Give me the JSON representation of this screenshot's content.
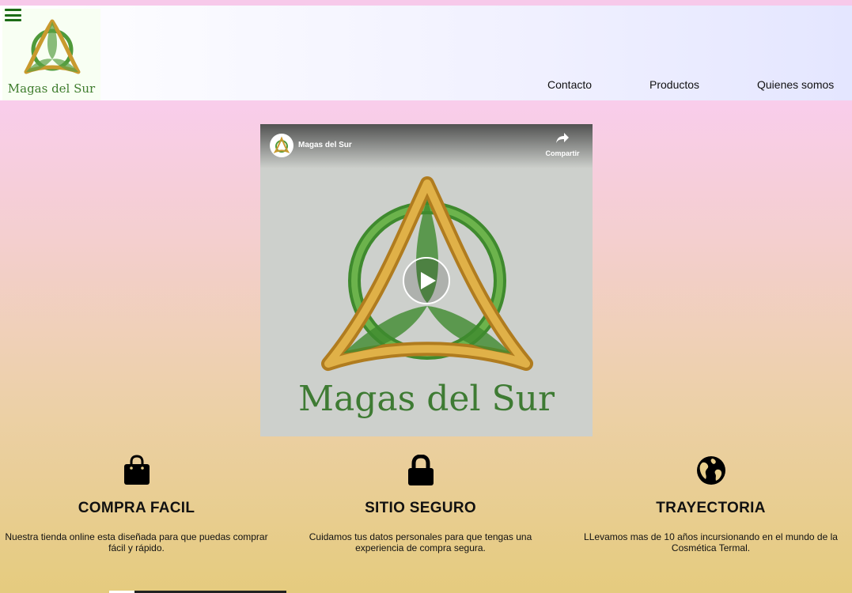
{
  "header": {
    "logo_text": "Magas del Sur",
    "nav": {
      "contact": "Contacto",
      "products": "Productos",
      "about": "Quienes somos"
    }
  },
  "video": {
    "channel": "Magas del Sur",
    "share_label": "Compartir",
    "title_art": "Magas del Sur"
  },
  "features": [
    {
      "icon": "shopping-bag-icon",
      "title": "COMPRA FACIL",
      "text": "Nuestra tienda online esta diseñada para que puedas comprar fácil y rápido."
    },
    {
      "icon": "lock-icon",
      "title": "SITIO SEGURO",
      "text": "Cuidamos tus datos personales para que tengas una experiencia de compra segura."
    },
    {
      "icon": "globe-icon",
      "title": "TRAYECTORIA",
      "text": "LLevamos mas de 10 años incursionando en el mundo de la Cosmética Termal."
    }
  ],
  "colors": {
    "accent_green": "#1c6b16",
    "knot_gold": "#c99a2e",
    "knot_green": "#4f9a3a"
  }
}
